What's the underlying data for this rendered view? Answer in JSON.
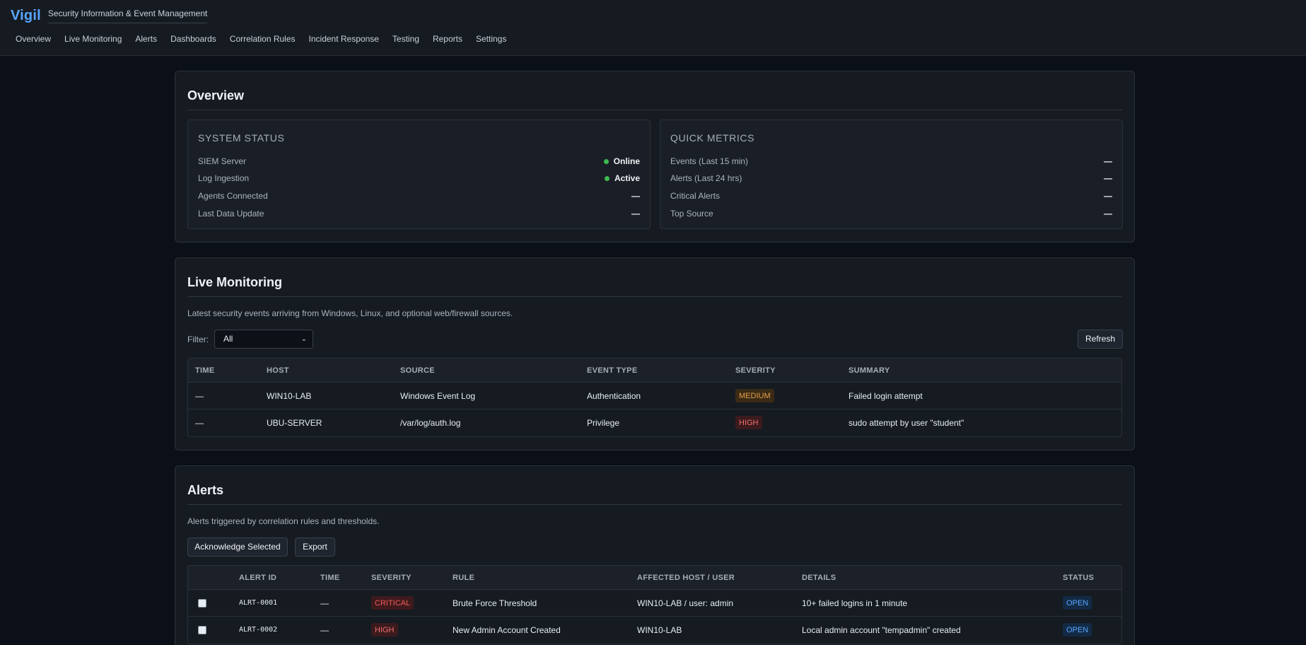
{
  "app": {
    "logo": "Vigil",
    "tagline": "Security Information & Event Management"
  },
  "nav": [
    "Overview",
    "Live Monitoring",
    "Alerts",
    "Dashboards",
    "Correlation Rules",
    "Incident Response",
    "Testing",
    "Reports",
    "Settings"
  ],
  "overview": {
    "title": "Overview",
    "system_status": {
      "title": "SYSTEM STATUS",
      "rows": [
        {
          "label": "SIEM Server",
          "value": "Online"
        },
        {
          "label": "Log Ingestion",
          "value": "Active"
        },
        {
          "label": "Agents Connected",
          "value": "—"
        },
        {
          "label": "Last Data Update",
          "value": "—"
        }
      ]
    },
    "quick_metrics": {
      "title": "QUICK METRICS",
      "rows": [
        {
          "label": "Events (Last 15 min)",
          "value": "—"
        },
        {
          "label": "Alerts (Last 24 hrs)",
          "value": "—"
        },
        {
          "label": "Critical Alerts",
          "value": "—"
        },
        {
          "label": "Top Source",
          "value": "—"
        }
      ]
    }
  },
  "live": {
    "title": "Live Monitoring",
    "description": "Latest security events arriving from Windows, Linux, and optional web/firewall sources.",
    "filter_label": "Filter:",
    "filter_value": "All",
    "refresh_label": "Refresh",
    "columns": [
      "TIME",
      "HOST",
      "SOURCE",
      "EVENT TYPE",
      "SEVERITY",
      "SUMMARY"
    ],
    "rows": [
      {
        "time": "—",
        "host": "WIN10-LAB",
        "source": "Windows Event Log",
        "event_type": "Authentication",
        "severity": "MEDIUM",
        "summary": "Failed login attempt"
      },
      {
        "time": "—",
        "host": "UBU-SERVER",
        "source": "/var/log/auth.log",
        "event_type": "Privilege",
        "severity": "HIGH",
        "summary": "sudo attempt by user \"student\""
      }
    ]
  },
  "alerts": {
    "title": "Alerts",
    "description": "Alerts triggered by correlation rules and thresholds.",
    "ack_label": "Acknowledge Selected",
    "export_label": "Export",
    "columns": [
      "ALERT ID",
      "TIME",
      "SEVERITY",
      "RULE",
      "AFFECTED HOST / USER",
      "DETAILS",
      "STATUS"
    ],
    "rows": [
      {
        "id": "ALRT-0001",
        "time": "—",
        "severity": "CRITICAL",
        "rule": "Brute Force Threshold",
        "affected": "WIN10-LAB / user: admin",
        "details": "10+ failed logins in 1 minute",
        "status": "OPEN"
      },
      {
        "id": "ALRT-0002",
        "time": "—",
        "severity": "HIGH",
        "rule": "New Admin Account Created",
        "affected": "WIN10-LAB",
        "details": "Local admin account \"tempadmin\" created",
        "status": "OPEN"
      }
    ]
  },
  "colors": {
    "accent": "#58a6ff",
    "online": "#3fb950",
    "medium": "#e3a24a",
    "high": "#f06e6e",
    "critical": "#f25a5a"
  }
}
